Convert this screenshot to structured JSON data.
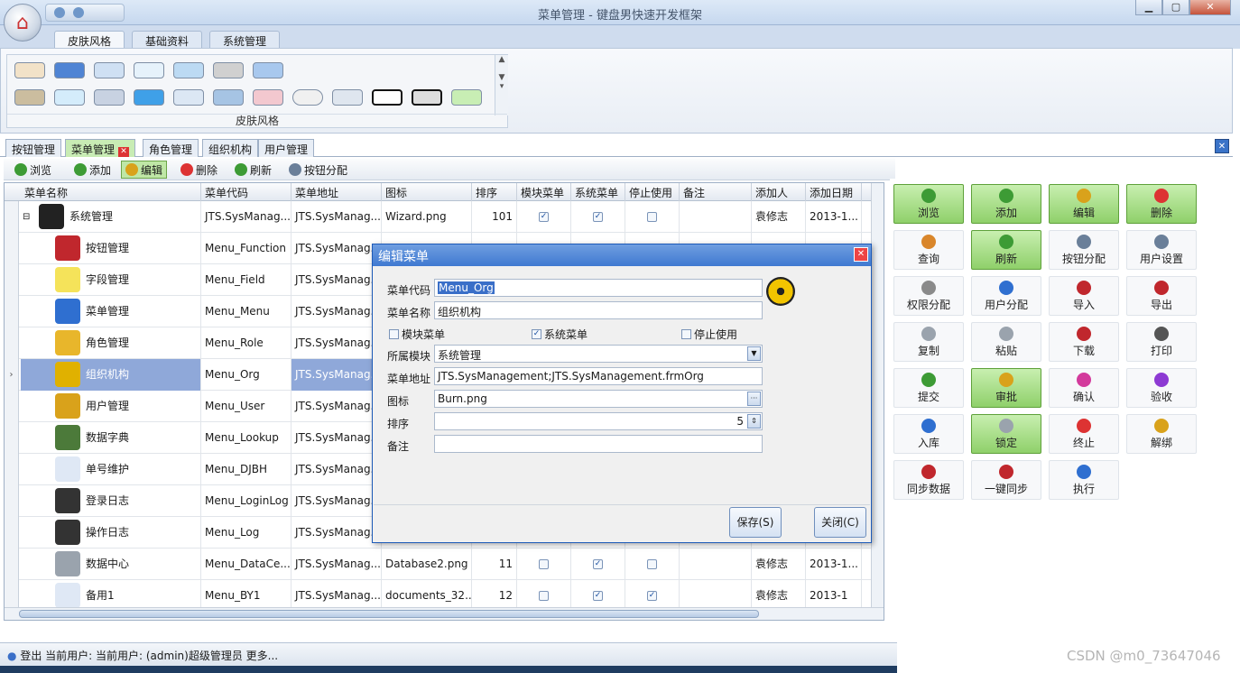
{
  "window": {
    "title": "菜单管理 - 键盘男快速开发框架"
  },
  "ribbon": {
    "tabs": [
      "皮肤风格",
      "基础资料",
      "系统管理"
    ],
    "gallery_label": "皮肤风格"
  },
  "doc_tabs": [
    "按钮管理",
    "菜单管理",
    "角色管理",
    "组织机构",
    "用户管理"
  ],
  "toolbar": {
    "items": [
      {
        "label": "浏览",
        "icon": "browse-icon",
        "color": "#3d9b35"
      },
      {
        "label": "添加",
        "icon": "add-icon",
        "color": "#3d9b35"
      },
      {
        "label": "编辑",
        "icon": "edit-icon",
        "color": "#d9a21b"
      },
      {
        "label": "删除",
        "icon": "delete-icon",
        "color": "#d33"
      },
      {
        "label": "刷新",
        "icon": "refresh-icon",
        "color": "#3d9b35"
      },
      {
        "label": "按钮分配",
        "icon": "wrench-icon",
        "color": "#6a7f99"
      }
    ]
  },
  "grid": {
    "columns": [
      "菜单名称",
      "菜单代码",
      "菜单地址",
      "图标",
      "排序",
      "模块菜单",
      "系统菜单",
      "停止使用",
      "备注",
      "添加人",
      "添加日期"
    ],
    "rows": [
      {
        "name": "系统管理",
        "code": "JTS.SysManag...",
        "addr": "JTS.SysManag...",
        "icon": "Wizard.png",
        "order": "101",
        "module": true,
        "system": true,
        "stop": false,
        "adder": "袁修志",
        "date": "2013-1...",
        "ico_color": "#222",
        "tree": "⊟"
      },
      {
        "name": "按钮管理",
        "code": "Menu_Function",
        "addr": "JTS.SysManag...",
        "icon": "",
        "order": "",
        "module": null,
        "system": null,
        "stop": null,
        "adder": "",
        "date": "",
        "ico_color": "#c0272d",
        "tree": ""
      },
      {
        "name": "字段管理",
        "code": "Menu_Field",
        "addr": "JTS.SysManag...",
        "icon": "",
        "order": "",
        "module": null,
        "system": null,
        "stop": null,
        "adder": "",
        "date": "",
        "ico_color": "#f5e35a",
        "tree": ""
      },
      {
        "name": "菜单管理",
        "code": "Menu_Menu",
        "addr": "JTS.SysManag...",
        "icon": "",
        "order": "",
        "module": null,
        "system": null,
        "stop": null,
        "adder": "",
        "date": "",
        "ico_color": "#2f6fd0",
        "tree": ""
      },
      {
        "name": "角色管理",
        "code": "Menu_Role",
        "addr": "JTS.SysManag...",
        "icon": "",
        "order": "",
        "module": null,
        "system": null,
        "stop": null,
        "adder": "",
        "date": "",
        "ico_color": "#e8b62b",
        "tree": ""
      },
      {
        "name": "组织机构",
        "code": "Menu_Org",
        "addr": "JTS.SysManag...",
        "icon": "",
        "order": "",
        "module": null,
        "system": null,
        "stop": null,
        "adder": "",
        "date": "",
        "ico_color": "#e0b100",
        "tree": "",
        "selected": true
      },
      {
        "name": "用户管理",
        "code": "Menu_User",
        "addr": "JTS.SysManag...",
        "icon": "",
        "order": "",
        "module": null,
        "system": null,
        "stop": null,
        "adder": "",
        "date": "",
        "ico_color": "#d9a21b",
        "tree": ""
      },
      {
        "name": "数据字典",
        "code": "Menu_Lookup",
        "addr": "JTS.SysManag...",
        "icon": "",
        "order": "",
        "module": null,
        "system": null,
        "stop": null,
        "adder": "",
        "date": "",
        "ico_color": "#4c7a3a",
        "tree": ""
      },
      {
        "name": "单号维护",
        "code": "Menu_DJBH",
        "addr": "JTS.SysManag...",
        "icon": "",
        "order": "",
        "module": null,
        "system": null,
        "stop": null,
        "adder": "",
        "date": "",
        "ico_color": "#dfe8f5",
        "tree": ""
      },
      {
        "name": "登录日志",
        "code": "Menu_LoginLog",
        "addr": "JTS.SysManag...",
        "icon": "",
        "order": "",
        "module": null,
        "system": null,
        "stop": null,
        "adder": "",
        "date": "",
        "ico_color": "#333",
        "tree": ""
      },
      {
        "name": "操作日志",
        "code": "Menu_Log",
        "addr": "JTS.SysManag...",
        "icon": "",
        "order": "",
        "module": null,
        "system": null,
        "stop": null,
        "adder": "",
        "date": "",
        "ico_color": "#333",
        "tree": ""
      },
      {
        "name": "数据中心",
        "code": "Menu_DataCe...",
        "addr": "JTS.SysManag...",
        "icon": "Database2.png",
        "order": "11",
        "module": false,
        "system": true,
        "stop": false,
        "adder": "袁修志",
        "date": "2013-1...",
        "ico_color": "#9aa3ad",
        "tree": ""
      },
      {
        "name": "备用1",
        "code": "Menu_BY1",
        "addr": "JTS.SysManag...",
        "icon": "documents_32...",
        "order": "12",
        "module": false,
        "system": true,
        "stop": true,
        "adder": "袁修志",
        "date": "2013-1",
        "ico_color": "#dfe8f5",
        "tree": ""
      }
    ]
  },
  "actions": [
    {
      "label": "浏览",
      "green": true,
      "color": "#3d9b35"
    },
    {
      "label": "添加",
      "green": true,
      "color": "#3d9b35"
    },
    {
      "label": "编辑",
      "green": true,
      "color": "#d9a21b"
    },
    {
      "label": "删除",
      "green": true,
      "color": "#d33"
    },
    {
      "label": "查询",
      "green": false,
      "color": "#d9862b"
    },
    {
      "label": "刷新",
      "green": true,
      "color": "#3d9b35"
    },
    {
      "label": "按钮分配",
      "green": false,
      "color": "#6a7f99"
    },
    {
      "label": "用户设置",
      "green": false,
      "color": "#6a7f99"
    },
    {
      "label": "权限分配",
      "green": false,
      "color": "#8a8a8a"
    },
    {
      "label": "用户分配",
      "green": false,
      "color": "#2f6fd0"
    },
    {
      "label": "导入",
      "green": false,
      "color": "#c0272d"
    },
    {
      "label": "导出",
      "green": false,
      "color": "#c0272d"
    },
    {
      "label": "复制",
      "green": false,
      "color": "#9aa3ad"
    },
    {
      "label": "粘贴",
      "green": false,
      "color": "#9aa3ad"
    },
    {
      "label": "下载",
      "green": false,
      "color": "#c0272d"
    },
    {
      "label": "打印",
      "green": false,
      "color": "#555"
    },
    {
      "label": "提交",
      "green": false,
      "color": "#3d9b35"
    },
    {
      "label": "审批",
      "green": true,
      "color": "#d9a21b"
    },
    {
      "label": "确认",
      "green": false,
      "color": "#d33a9c"
    },
    {
      "label": "验收",
      "green": false,
      "color": "#8d3ad3"
    },
    {
      "label": "入库",
      "green": false,
      "color": "#2f6fd0"
    },
    {
      "label": "锁定",
      "green": true,
      "color": "#9aa3ad"
    },
    {
      "label": "终止",
      "green": false,
      "color": "#d33"
    },
    {
      "label": "解绑",
      "green": false,
      "color": "#d9a21b"
    },
    {
      "label": "同步数据",
      "green": false,
      "color": "#c0272d"
    },
    {
      "label": "一键同步",
      "green": false,
      "color": "#c0272d"
    },
    {
      "label": "执行",
      "green": false,
      "color": "#2f6fd0"
    }
  ],
  "dialog": {
    "title": "编辑菜单",
    "code_label": "菜单代码",
    "code_value": "Menu_Org",
    "name_label": "菜单名称",
    "name_value": "组织机构",
    "chk_module": "模块菜单",
    "chk_system": "系统菜单",
    "chk_stop": "停止使用",
    "module_label": "所属模块",
    "module_value": "系统管理",
    "addr_label": "菜单地址",
    "addr_value": "JTS.SysManagement;JTS.SysManagement.frmOrg",
    "icon_label": "图标",
    "icon_value": "Burn.png",
    "order_label": "排序",
    "order_value": "5",
    "remark_label": "备注",
    "remark_value": "",
    "save": "保存(S)",
    "close": "关闭(C)"
  },
  "status": {
    "logout": "登出",
    "user": "当前用户: 当前用户: (admin)超级管理员 更多..."
  },
  "watermark": "CSDN @m0_73647046"
}
